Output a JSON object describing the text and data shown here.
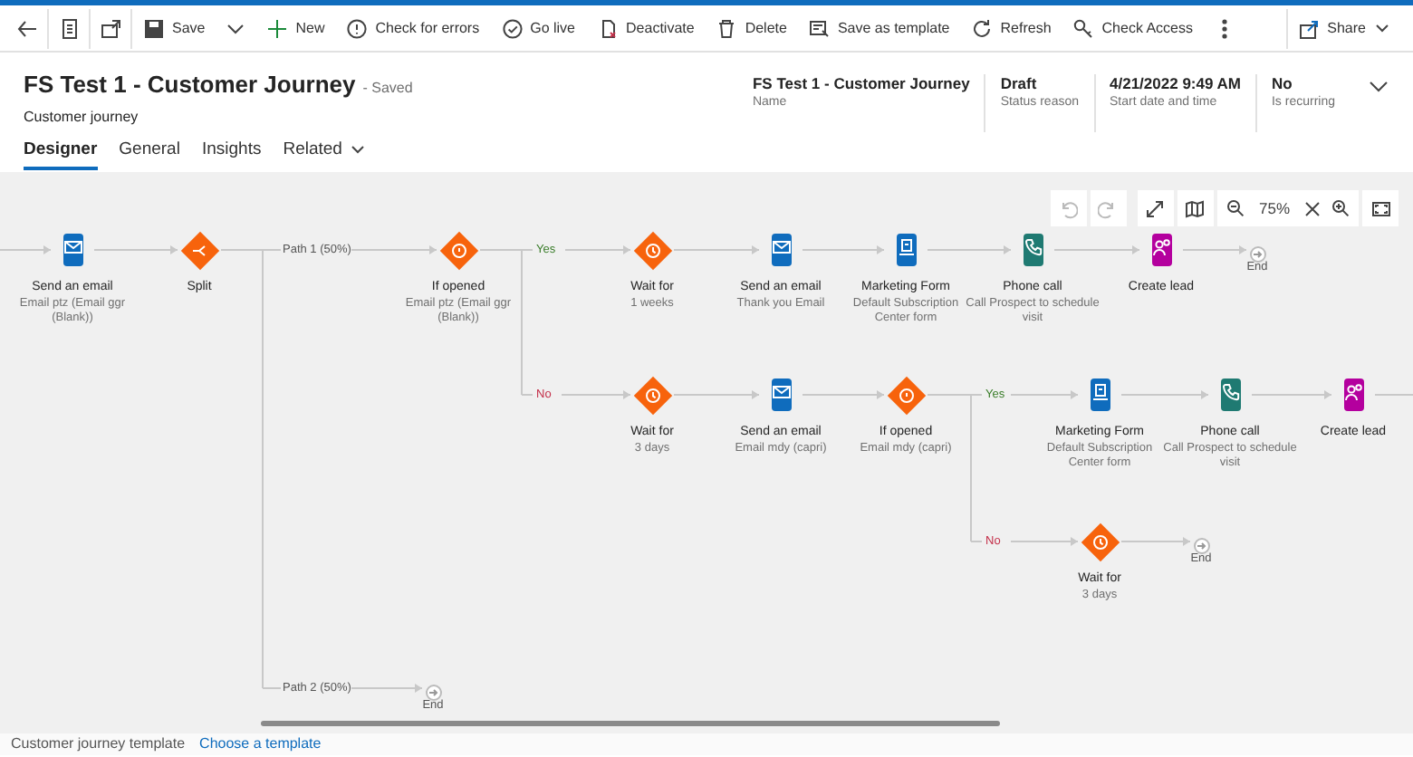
{
  "toolbar": [
    {
      "kind": "back"
    },
    {
      "kind": "page"
    },
    {
      "kind": "popout"
    },
    {
      "kind": "save",
      "label": "Save"
    },
    {
      "kind": "caret"
    },
    {
      "kind": "new",
      "label": "New"
    },
    {
      "kind": "check",
      "label": "Check for errors"
    },
    {
      "kind": "golive",
      "label": "Go live"
    },
    {
      "kind": "deactivate",
      "label": "Deactivate"
    },
    {
      "kind": "delete",
      "label": "Delete"
    },
    {
      "kind": "template",
      "label": "Save as template"
    },
    {
      "kind": "refresh",
      "label": "Refresh"
    },
    {
      "kind": "access",
      "label": "Check Access"
    },
    {
      "kind": "more"
    }
  ],
  "share": {
    "label": "Share"
  },
  "header": {
    "title": "FS Test 1 - Customer Journey",
    "status": "- Saved",
    "subtitle": "Customer journey",
    "fields": [
      {
        "value": "FS Test 1 - Customer Journey",
        "label": "Name"
      },
      {
        "value": "Draft",
        "label": "Status reason"
      },
      {
        "value": "4/21/2022 9:49 AM",
        "label": "Start date and time"
      },
      {
        "value": "No",
        "label": "Is recurring"
      }
    ]
  },
  "tabs": [
    {
      "label": "Designer",
      "selected": true,
      "has_menu": false
    },
    {
      "label": "General",
      "selected": false,
      "has_menu": false
    },
    {
      "label": "Insights",
      "selected": false,
      "has_menu": false
    },
    {
      "label": "Related",
      "selected": false,
      "has_menu": true
    }
  ],
  "canvas_controls": {
    "zoom": "75%"
  },
  "nodes": [
    {
      "kind": "email",
      "title": "Send an email",
      "subtitle": "Email ptz (Email ggr (Blank))"
    },
    {
      "kind": "split",
      "title": "Split"
    },
    {
      "kind": "condition",
      "title": "If opened",
      "subtitle": "Email ptz (Email ggr (Blank))"
    },
    {
      "kind": "wait",
      "title": "Wait for",
      "subtitle": "1 weeks"
    },
    {
      "kind": "email",
      "title": "Send an email",
      "subtitle": "Thank you Email"
    },
    {
      "kind": "form",
      "title": "Marketing Form",
      "subtitle": "Default Subscription Center form"
    },
    {
      "kind": "phone",
      "title": "Phone call",
      "subtitle": "Call Prospect to schedule visit"
    },
    {
      "kind": "lead",
      "title": "Create lead"
    },
    {
      "kind": "end",
      "title": "End"
    },
    {
      "kind": "wait",
      "title": "Wait for",
      "subtitle": "3 days"
    },
    {
      "kind": "email",
      "title": "Send an email",
      "subtitle": "Email mdy (capri)"
    },
    {
      "kind": "condition",
      "title": "If opened",
      "subtitle": "Email mdy (capri)"
    },
    {
      "kind": "form",
      "title": "Marketing Form",
      "subtitle": "Default Subscription Center form"
    },
    {
      "kind": "phone",
      "title": "Phone call",
      "subtitle": "Call Prospect to schedule visit"
    },
    {
      "kind": "lead",
      "title": "Create lead"
    },
    {
      "kind": "wait",
      "title": "Wait for",
      "subtitle": "3 days"
    },
    {
      "kind": "end",
      "title": "End"
    },
    {
      "kind": "end",
      "title": "End"
    }
  ],
  "branches": [
    {
      "kind": "path",
      "label": "Path 1 (50%)"
    },
    {
      "kind": "yes",
      "label": "Yes"
    },
    {
      "kind": "no",
      "label": "No"
    },
    {
      "kind": "yes",
      "label": "Yes"
    },
    {
      "kind": "no",
      "label": "No"
    },
    {
      "kind": "path",
      "label": "Path 2 (50%)"
    }
  ],
  "footer": {
    "label": "Customer journey template",
    "link": "Choose a template"
  }
}
